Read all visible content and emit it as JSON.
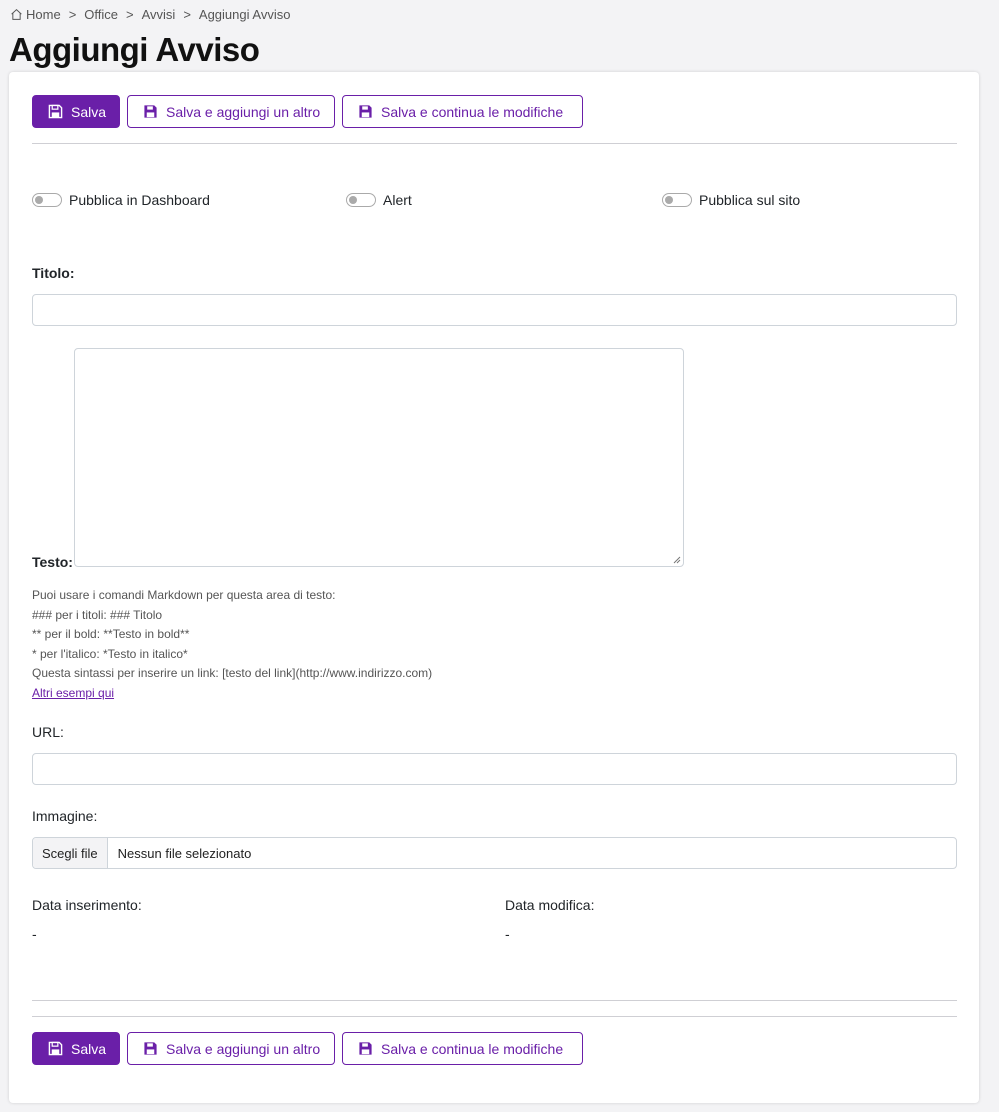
{
  "breadcrumb": {
    "items": [
      "Home",
      "Office",
      "Avvisi",
      "Aggiungi Avviso"
    ],
    "separator": ">"
  },
  "page_title": "Aggiungi Avviso",
  "toolbar": {
    "save_label": "Salva",
    "save_add_label": "Salva e aggiungi un altro",
    "save_continue_label": "Salva e continua le modifiche"
  },
  "toggles": {
    "dashboard_label": "Pubblica in Dashboard",
    "alert_label": "Alert",
    "site_label": "Pubblica sul sito"
  },
  "form": {
    "titolo_label": "Titolo:",
    "titolo_value": "",
    "testo_label": "Testo:",
    "testo_value": "",
    "help": {
      "line1": "Puoi usare i comandi Markdown per questa area di testo:",
      "line2": "### per i titoli: ### Titolo",
      "line3": "** per il bold: **Testo in bold**",
      "line4": "* per l'italico: *Testo in italico*",
      "line5": "Questa sintassi per inserire un link: [testo del link](http://www.indirizzo.com)",
      "link_label": "Altri esempi qui"
    },
    "url_label": "URL:",
    "url_value": "",
    "immagine_label": "Immagine:",
    "file_button_label": "Scegli file",
    "file_status": "Nessun file selezionato",
    "data_inserimento_label": "Data inserimento:",
    "data_inserimento_value": "-",
    "data_modifica_label": "Data modifica:",
    "data_modifica_value": "-"
  },
  "icons": {
    "home": "home-icon",
    "save": "floppy-disk-icon"
  },
  "colors": {
    "accent": "#6a1fa8",
    "background": "#f3f3f5"
  }
}
